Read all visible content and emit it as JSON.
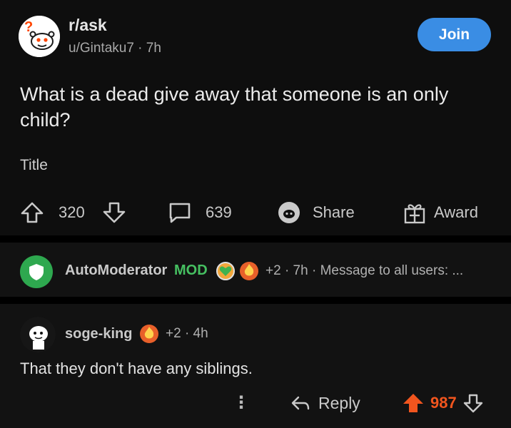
{
  "post": {
    "subreddit": "r/ask",
    "author_meta": "u/Gintaku7 · 7h",
    "join_label": "Join",
    "title": "What is a dead give away that someone is an only child?",
    "flair": "Title",
    "upvotes": "320",
    "comments": "639",
    "share_label": "Share",
    "award_label": "Award"
  },
  "mod_comment": {
    "author": "AutoModerator",
    "mod_tag": "MOD",
    "meta": "+2 · 7h · Message to all users: ..."
  },
  "comment": {
    "author": "soge-king",
    "meta": "+2 · 4h",
    "body": "That they don't have any siblings.",
    "more_label": "⋮",
    "reply_label": "Reply",
    "score": "987"
  },
  "colors": {
    "background": "#0e0e0e",
    "join_button": "#3a8de4",
    "mod_green": "#46c061",
    "upvote_orange": "#f1551e"
  }
}
